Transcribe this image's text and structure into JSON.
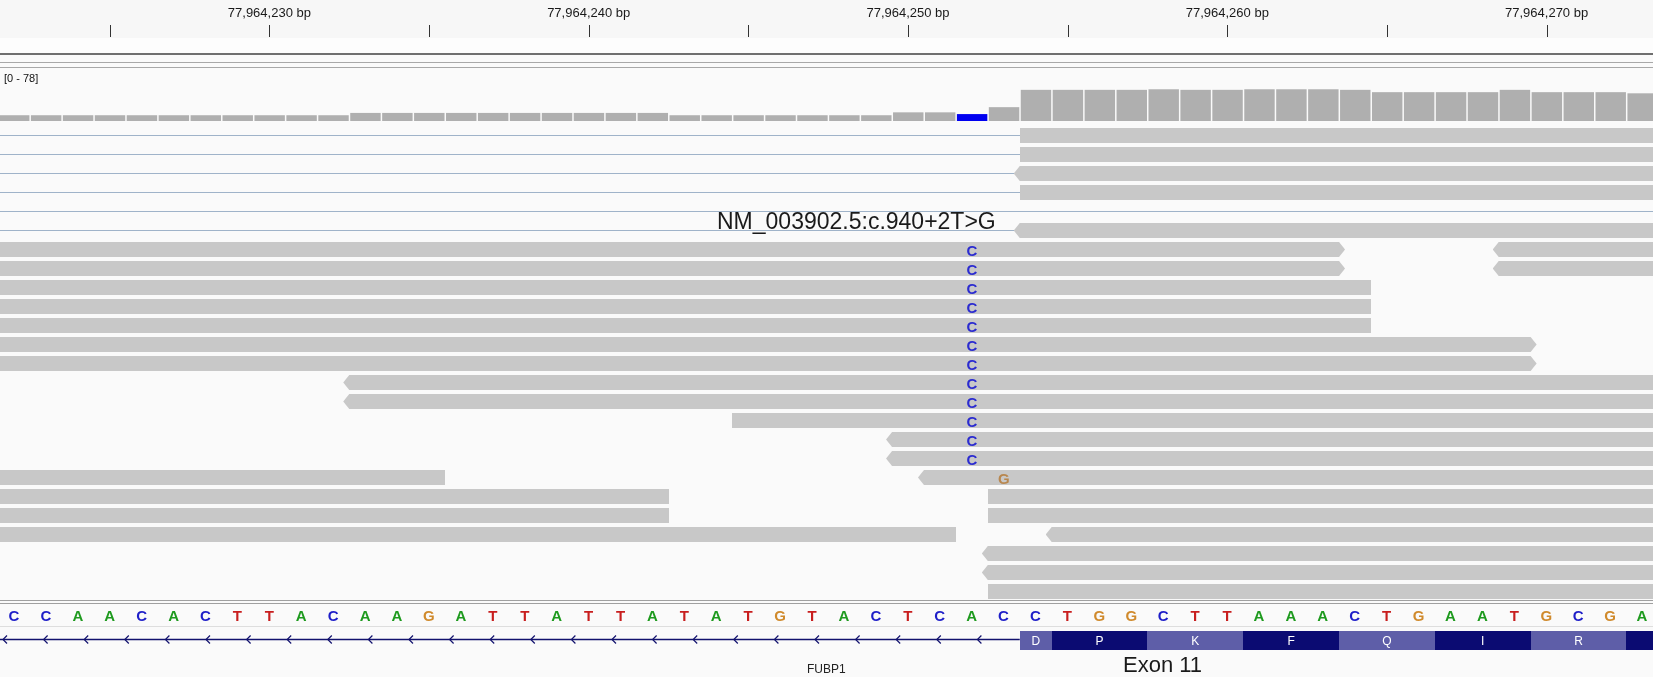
{
  "ruler": {
    "labels": [
      "77,964,230 bp",
      "77,964,240 bp",
      "77,964,250 bp",
      "77,964,260 bp",
      "77,964,270 bp"
    ]
  },
  "coverage": {
    "range_label": "[0 - 78]",
    "bars": [
      {
        "color": "#afafaf"
      },
      {
        "color": "#afafaf"
      },
      {
        "color": "#afafaf"
      },
      {
        "color": "#afafaf"
      },
      {
        "color": "#afafaf"
      },
      {
        "color": "#afafaf"
      },
      {
        "color": "#afafaf"
      },
      {
        "color": "#afafaf"
      },
      {
        "color": "#afafaf"
      },
      {
        "color": "#afafaf"
      },
      {
        "color": "#afafaf"
      },
      {
        "color": "#afafaf"
      },
      {
        "color": "#afafaf"
      },
      {
        "color": "#afafaf"
      },
      {
        "color": "#afafaf"
      },
      {
        "color": "#afafaf"
      },
      {
        "color": "#afafaf"
      },
      {
        "color": "#afafaf"
      },
      {
        "color": "#afafaf"
      },
      {
        "color": "#afafaf"
      },
      {
        "color": "#afafaf"
      },
      {
        "color": "#afafaf"
      },
      {
        "color": "#afafaf"
      },
      {
        "color": "#afafaf"
      },
      {
        "color": "#afafaf"
      },
      {
        "color": "#afafaf"
      },
      {
        "color": "#afafaf"
      },
      {
        "color": "#afafaf"
      },
      {
        "color": "#afafaf"
      },
      {
        "color": "#afafaf"
      },
      {
        "color": "#0000f0"
      },
      {
        "color": "#afafaf"
      },
      {
        "color": "#afafaf"
      },
      {
        "color": "#afafaf"
      },
      {
        "color": "#afafaf"
      },
      {
        "color": "#afafaf"
      },
      {
        "color": "#afafaf"
      },
      {
        "color": "#afafaf"
      },
      {
        "color": "#afafaf"
      },
      {
        "color": "#afafaf"
      },
      {
        "color": "#afafaf"
      },
      {
        "color": "#afafaf"
      },
      {
        "color": "#afafaf"
      },
      {
        "color": "#afafaf"
      },
      {
        "color": "#afafaf"
      },
      {
        "color": "#afafaf"
      },
      {
        "color": "#afafaf"
      },
      {
        "color": "#afafaf"
      },
      {
        "color": "#afafaf"
      },
      {
        "color": "#afafaf"
      },
      {
        "color": "#afafaf"
      },
      {
        "color": "#afafaf"
      }
    ]
  },
  "alignments": {
    "variant_label": "NM_003902.5:c.940+2T>G",
    "rows": [
      {
        "items": [
          {
            "kind": "mate-line"
          },
          {
            "kind": "read",
            "reverse": false
          }
        ]
      },
      {
        "items": [
          {
            "kind": "mate-line"
          },
          {
            "kind": "read",
            "reverse": false
          }
        ]
      },
      {
        "items": [
          {
            "kind": "mate-line"
          },
          {
            "kind": "read",
            "reverse": true
          }
        ]
      },
      {
        "items": [
          {
            "kind": "mate-line"
          },
          {
            "kind": "read",
            "reverse": false
          }
        ]
      },
      {
        "items": [
          {
            "kind": "mate-line"
          }
        ]
      },
      {
        "items": [
          {
            "kind": "mate-line"
          },
          {
            "kind": "read",
            "reverse": true
          }
        ]
      },
      {
        "items": [
          {
            "kind": "read",
            "reverse": false,
            "mismatches": [
              {
                "base": "C",
                "color": "#2b2bd0"
              }
            ]
          },
          {
            "kind": "read",
            "reverse": true
          }
        ]
      },
      {
        "items": [
          {
            "kind": "read",
            "reverse": false,
            "mismatches": [
              {
                "base": "C",
                "color": "#2b2bd0"
              }
            ]
          },
          {
            "kind": "read",
            "reverse": true
          }
        ]
      },
      {
        "items": [
          {
            "kind": "read",
            "reverse": true,
            "mismatches": [
              {
                "base": "C",
                "color": "#2b2bd0"
              }
            ]
          }
        ]
      },
      {
        "items": [
          {
            "kind": "read",
            "reverse": true,
            "mismatches": [
              {
                "base": "C",
                "color": "#2b2bd0"
              }
            ]
          }
        ]
      },
      {
        "items": [
          {
            "kind": "read",
            "reverse": true,
            "mismatches": [
              {
                "base": "C",
                "color": "#2b2bd0"
              }
            ]
          }
        ]
      },
      {
        "items": [
          {
            "kind": "read",
            "reverse": false,
            "mismatches": [
              {
                "base": "C",
                "color": "#2b2bd0"
              }
            ]
          }
        ]
      },
      {
        "items": [
          {
            "kind": "read",
            "reverse": false,
            "mismatches": [
              {
                "base": "C",
                "color": "#2b2bd0"
              }
            ]
          }
        ]
      },
      {
        "items": [
          {
            "kind": "read",
            "reverse": true,
            "mismatches": [
              {
                "base": "C",
                "color": "#2b2bd0"
              }
            ]
          }
        ]
      },
      {
        "items": [
          {
            "kind": "read",
            "reverse": true,
            "mismatches": [
              {
                "base": "C",
                "color": "#2b2bd0"
              }
            ]
          }
        ]
      },
      {
        "items": [
          {
            "kind": "read",
            "reverse": false,
            "mismatches": [
              {
                "base": "C",
                "color": "#2b2bd0"
              }
            ]
          }
        ]
      },
      {
        "items": [
          {
            "kind": "read",
            "reverse": true,
            "mismatches": [
              {
                "base": "C",
                "color": "#2b2bd0"
              }
            ]
          }
        ]
      },
      {
        "items": [
          {
            "kind": "read",
            "reverse": true,
            "mismatches": [
              {
                "base": "C",
                "color": "#2b2bd0"
              }
            ]
          }
        ]
      },
      {
        "items": [
          {
            "kind": "read",
            "reverse": true
          },
          {
            "kind": "read",
            "reverse": true,
            "mismatches": [
              {
                "base": "G",
                "color": "#b8874f"
              }
            ]
          }
        ]
      },
      {
        "items": [
          {
            "kind": "read",
            "reverse": true
          },
          {
            "kind": "read",
            "reverse": false
          }
        ]
      },
      {
        "items": [
          {
            "kind": "read",
            "reverse": true
          },
          {
            "kind": "read",
            "reverse": false
          }
        ]
      },
      {
        "items": [
          {
            "kind": "read",
            "reverse": true
          },
          {
            "kind": "read",
            "reverse": true
          }
        ]
      },
      {
        "items": [
          {
            "kind": "read",
            "reverse": true
          }
        ]
      },
      {
        "items": [
          {
            "kind": "read",
            "reverse": true
          }
        ]
      },
      {
        "items": [
          {
            "kind": "read",
            "reverse": false
          }
        ]
      }
    ]
  },
  "sequence": [
    {
      "base": "C",
      "color": "#1e1ec8"
    },
    {
      "base": "C",
      "color": "#1e1ec8"
    },
    {
      "base": "A",
      "color": "#1e9a1e"
    },
    {
      "base": "A",
      "color": "#1e9a1e"
    },
    {
      "base": "C",
      "color": "#1e1ec8"
    },
    {
      "base": "A",
      "color": "#1e9a1e"
    },
    {
      "base": "C",
      "color": "#1e1ec8"
    },
    {
      "base": "T",
      "color": "#c81e1e"
    },
    {
      "base": "T",
      "color": "#c81e1e"
    },
    {
      "base": "A",
      "color": "#1e9a1e"
    },
    {
      "base": "C",
      "color": "#1e1ec8"
    },
    {
      "base": "A",
      "color": "#1e9a1e"
    },
    {
      "base": "A",
      "color": "#1e9a1e"
    },
    {
      "base": "G",
      "color": "#d08a2c"
    },
    {
      "base": "A",
      "color": "#1e9a1e"
    },
    {
      "base": "T",
      "color": "#c81e1e"
    },
    {
      "base": "T",
      "color": "#c81e1e"
    },
    {
      "base": "A",
      "color": "#1e9a1e"
    },
    {
      "base": "T",
      "color": "#c81e1e"
    },
    {
      "base": "T",
      "color": "#c81e1e"
    },
    {
      "base": "A",
      "color": "#1e9a1e"
    },
    {
      "base": "T",
      "color": "#c81e1e"
    },
    {
      "base": "A",
      "color": "#1e9a1e"
    },
    {
      "base": "T",
      "color": "#c81e1e"
    },
    {
      "base": "G",
      "color": "#d08a2c"
    },
    {
      "base": "T",
      "color": "#c81e1e"
    },
    {
      "base": "A",
      "color": "#1e9a1e"
    },
    {
      "base": "C",
      "color": "#1e1ec8"
    },
    {
      "base": "T",
      "color": "#c81e1e"
    },
    {
      "base": "C",
      "color": "#1e1ec8"
    },
    {
      "base": "A",
      "color": "#1e9a1e"
    },
    {
      "base": "C",
      "color": "#1e1ec8"
    },
    {
      "base": "C",
      "color": "#1e1ec8"
    },
    {
      "base": "T",
      "color": "#c81e1e"
    },
    {
      "base": "G",
      "color": "#d08a2c"
    },
    {
      "base": "G",
      "color": "#d08a2c"
    },
    {
      "base": "C",
      "color": "#1e1ec8"
    },
    {
      "base": "T",
      "color": "#c81e1e"
    },
    {
      "base": "T",
      "color": "#c81e1e"
    },
    {
      "base": "A",
      "color": "#1e9a1e"
    },
    {
      "base": "A",
      "color": "#1e9a1e"
    },
    {
      "base": "A",
      "color": "#1e9a1e"
    },
    {
      "base": "C",
      "color": "#1e1ec8"
    },
    {
      "base": "T",
      "color": "#c81e1e"
    },
    {
      "base": "G",
      "color": "#d08a2c"
    },
    {
      "base": "A",
      "color": "#1e9a1e"
    },
    {
      "base": "A",
      "color": "#1e9a1e"
    },
    {
      "base": "T",
      "color": "#c81e1e"
    },
    {
      "base": "G",
      "color": "#d08a2c"
    },
    {
      "base": "C",
      "color": "#1e1ec8"
    },
    {
      "base": "G",
      "color": "#d08a2c"
    },
    {
      "base": "A",
      "color": "#1e9a1e"
    }
  ],
  "gene_track": {
    "reverse": true,
    "amino_acids": [
      {
        "letter": "D",
        "color": "#5e5ea8"
      },
      {
        "letter": "P",
        "color": "#0b0b72"
      },
      {
        "letter": "K",
        "color": "#5e5ea8"
      },
      {
        "letter": "F",
        "color": "#0b0b72"
      },
      {
        "letter": "Q",
        "color": "#5e5ea8"
      },
      {
        "letter": "I",
        "color": "#0b0b72"
      },
      {
        "letter": "R",
        "color": "#5e5ea8"
      },
      {
        "color": "#0b0b72"
      }
    ],
    "gene_name": "FUBP1",
    "exon_label": "Exon 11"
  }
}
